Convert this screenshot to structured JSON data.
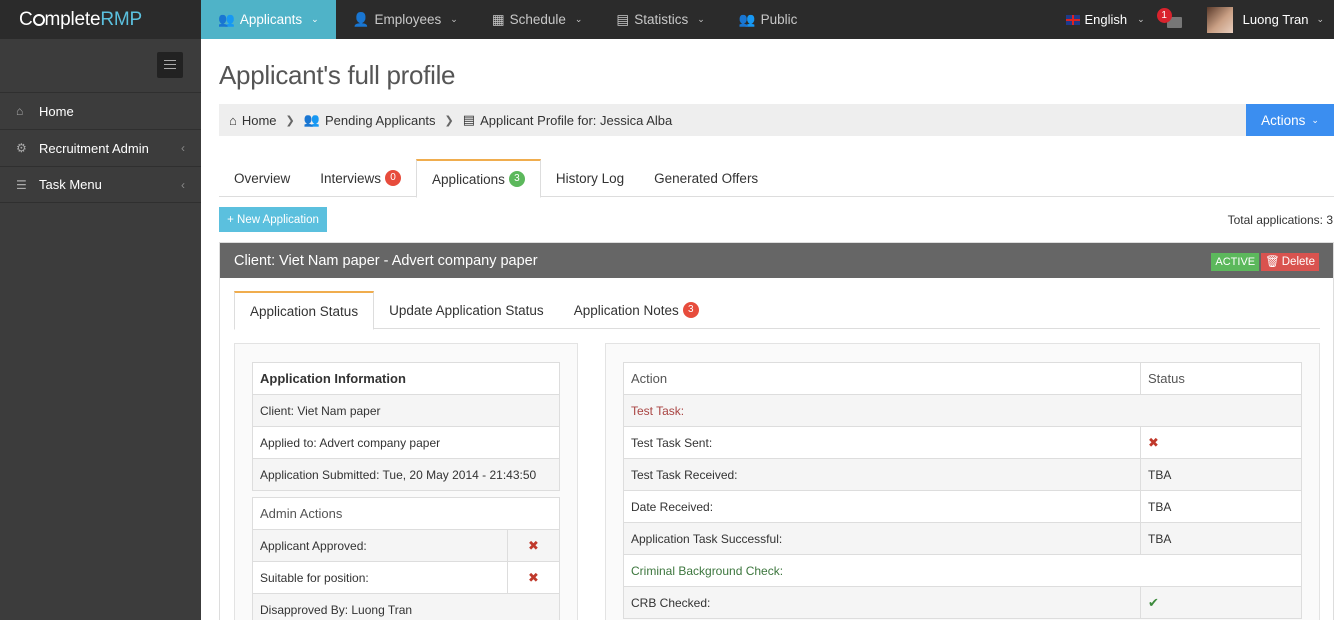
{
  "brand": {
    "part1": "C",
    "part2": "mplete",
    "part3": "RMP"
  },
  "topnav": [
    {
      "label": "Applicants",
      "icon": "users-icon",
      "active": true,
      "dropdown": true
    },
    {
      "label": "Employees",
      "icon": "user-icon",
      "dropdown": true
    },
    {
      "label": "Schedule",
      "icon": "calendar-icon",
      "dropdown": true
    },
    {
      "label": "Statistics",
      "icon": "bar-chart-icon",
      "dropdown": true
    },
    {
      "label": "Public",
      "icon": "users-icon",
      "dropdown": false
    }
  ],
  "header": {
    "language": "English",
    "notifications_count": "1",
    "user_name": "Luong Tran"
  },
  "sidebar": {
    "items": [
      {
        "label": "Home",
        "icon": "home-icon"
      },
      {
        "label": "Recruitment Admin",
        "icon": "gear-icon"
      },
      {
        "label": "Task Menu",
        "icon": "list-icon"
      }
    ]
  },
  "page": {
    "title": "Applicant's full profile"
  },
  "breadcrumb": {
    "home": "Home",
    "pending": "Pending Applicants",
    "current": "Applicant Profile for: Jessica Alba",
    "actions": "Actions"
  },
  "tabs": {
    "overview": "Overview",
    "interviews": "Interviews",
    "interviews_count": "0",
    "applications": "Applications",
    "applications_count": "3",
    "history": "History Log",
    "offers": "Generated Offers"
  },
  "toolbar": {
    "new_application": "+ New Application",
    "total": "Total applications: 3"
  },
  "panel": {
    "title": "Client: Viet Nam paper - Advert company paper",
    "status": "ACTIVE",
    "delete": "Delete"
  },
  "inner_tabs": {
    "status": "Application Status",
    "update": "Update Application Status",
    "notes": "Application Notes",
    "notes_count": "3"
  },
  "app_info": {
    "heading": "Application Information",
    "client": "Client: Viet Nam paper",
    "applied": "Applied to: Advert company paper",
    "submitted": "Application Submitted: Tue, 20 May 2014 - 21:43:50"
  },
  "admin_actions": {
    "heading": "Admin Actions",
    "approved": "Applicant Approved:",
    "suitable": "Suitable for position:",
    "disapproved": "Disapproved By: Luong Tran"
  },
  "status_table": {
    "col_action": "Action",
    "col_status": "Status",
    "section1": "Test Task:",
    "rows1": [
      {
        "action": "Test Task Sent:",
        "status": ""
      },
      {
        "action": "Test Task Received:",
        "status": "TBA"
      },
      {
        "action": "Date Received:",
        "status": "TBA"
      },
      {
        "action": "Application Task Successful:",
        "status": "TBA"
      }
    ],
    "section2": "Criminal Background Check:",
    "crb": "CRB Checked:"
  },
  "colors": {
    "accent": "#4fb3c8",
    "actions": "#3b8ef0",
    "active_label": "#5cb85c",
    "delete_label": "#d9534f"
  }
}
